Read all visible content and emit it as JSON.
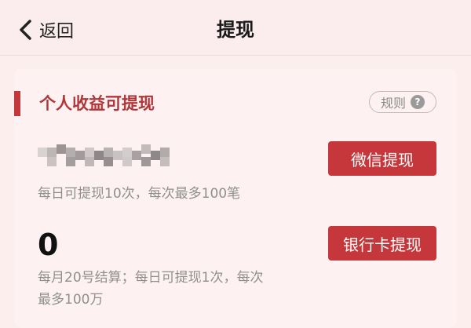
{
  "header": {
    "back_label": "返回",
    "title": "提现"
  },
  "section": {
    "title": "个人收益可提现",
    "rules_label": "规则",
    "help_glyph": "?"
  },
  "wechat": {
    "amount_masked": "blurred",
    "limit_text": "每日可提现10次，每次最多100笔",
    "button_label": "微信提现"
  },
  "bank": {
    "amount": "0",
    "limit_text": "每月20号结算；每日可提现1次，每次最多100万",
    "button_label": "银行卡提现"
  },
  "colors": {
    "accent": "#c6373b",
    "title_red": "#b0363a",
    "background": "#fdeeee"
  }
}
